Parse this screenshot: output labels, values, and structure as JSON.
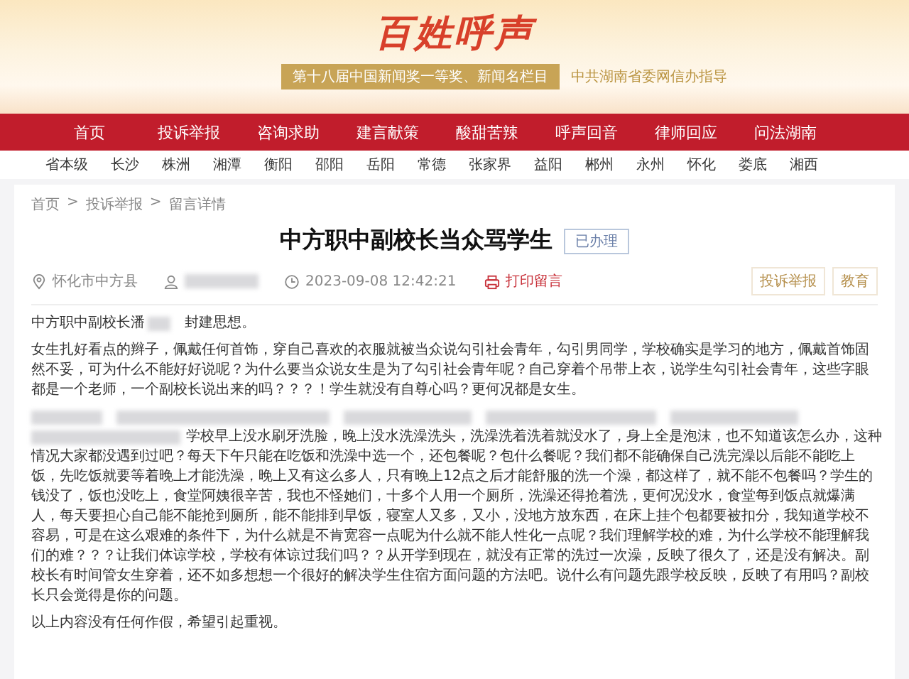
{
  "header": {
    "logo": "百姓呼声",
    "award": "第十八届中国新闻奖一等奖、新闻名栏目",
    "guide": "中共湖南省委网信办指导"
  },
  "nav": [
    "首页",
    "投诉举报",
    "咨询求助",
    "建言献策",
    "酸甜苦辣",
    "呼声回音",
    "律师回应",
    "问法湖南"
  ],
  "regions": [
    "省本级",
    "长沙",
    "株洲",
    "湘潭",
    "衡阳",
    "邵阳",
    "岳阳",
    "常德",
    "张家界",
    "益阳",
    "郴州",
    "永州",
    "怀化",
    "娄底",
    "湘西"
  ],
  "breadcrumb": [
    "首页",
    "投诉举报",
    "留言详情"
  ],
  "breadcrumb_separator": ">",
  "article": {
    "title": "中方职中副校长当众骂学生",
    "status": "已办理",
    "location": "怀化市中方县",
    "time": "2023-09-08 12:42:21",
    "print": "打印留言",
    "tags": [
      "投诉举报",
      "教育"
    ],
    "intro_before": "中方职中副校长潘",
    "intro_after": "封建思想。",
    "paragraphs": [
      {
        "kind": "plain",
        "text": "女生扎好看点的辫子，佩戴任何首饰，穿自己喜欢的衣服就被当众说勾引社会青年，勾引男同学，学校确实是学习的地方，佩戴首饰固然不妥，可为什么不能好好说呢？为什么要当众说女生是为了勾引社会青年呢？自己穿着个吊带上衣，说学生勾引社会青年，这些字眼都是一个老师，一个副校长说出来的吗？？？！学生就没有自尊心吗？更何况都是女生。"
      },
      {
        "kind": "redacted_lead",
        "lead_text": "学校早上没水刷牙洗脸，晚上没水洗澡洗头，洗澡洗着洗着就没水了，身上全是泡沫，也不知道该怎么办，这种",
        "text": "情况大家都没遇到过吧？每天下午只能在吃饭和洗澡中选一个，还包餐呢？包什么餐呢？我们都不能确保自己洗完澡以后能不能吃上饭，先吃饭就要等着晚上才能洗澡，晚上又有这么多人，只有晚上12点之后才能舒服的洗一个澡，都这样了，就不能不包餐吗？学生的钱没了，饭也没吃上，食堂阿姨很辛苦，我也不怪她们，十多个人用一个厕所，洗澡还得抢着洗，更何况没水，食堂每到饭点就爆满人，每天要担心自己能不能抢到厕所，能不能排到早饭，寝室人又多，又小，没地方放东西，在床上挂个包都要被扣分，我知道学校不容易，可是在这么艰难的条件下，为什么就是不肯宽容一点呢为什么就不能人性化一点呢？我们理解学校的难，为什么学校不能理解我们的难？？？让我们体谅学校，学校有体谅过我们吗？？从开学到现在，就没有正常的洗过一次澡，反映了很久了，还是没有解决。副校长有时间管女生穿着，还不如多想想一个很好的解决学生住宿方面问题的方法吧。说什么有问题先跟学校反映，反映了有用吗？副校长只会觉得是你的问题。"
      },
      {
        "kind": "plain",
        "text": "以上内容没有任何作假，希望引起重视。"
      }
    ]
  }
}
